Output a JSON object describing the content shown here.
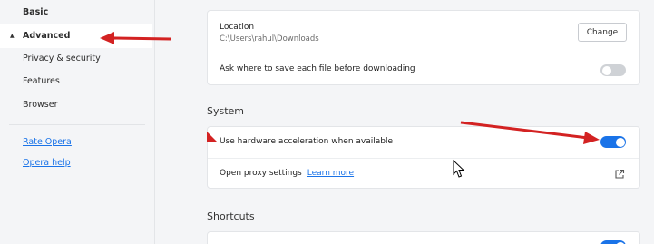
{
  "sidebar": {
    "basic": "Basic",
    "advanced": "Advanced",
    "advanced_caret": "▲",
    "sub_items": [
      "Privacy & security",
      "Features",
      "Browser"
    ],
    "links": [
      "Rate Opera",
      "Opera help"
    ]
  },
  "downloads": {
    "location_label": "Location",
    "location_value": "C:\\Users\\rahul\\Downloads",
    "change_button": "Change",
    "ask_label": "Ask where to save each file before downloading",
    "ask_toggle_on": false
  },
  "system": {
    "title": "System",
    "hw_accel_label": "Use hardware acceleration when available",
    "hw_accel_toggle_on": true,
    "proxy_label": "Open proxy settings",
    "learn_more": "Learn more",
    "proxy_icon": "open-external-icon"
  },
  "shortcuts": {
    "title": "Shortcuts",
    "toggle_on": true
  },
  "colors": {
    "accent": "#1a73e8",
    "annotation_arrow": "#d32222"
  }
}
